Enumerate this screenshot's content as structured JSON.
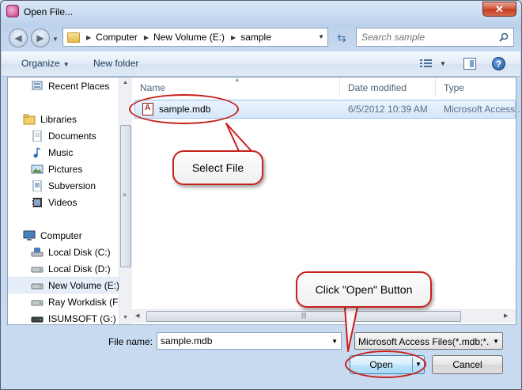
{
  "window": {
    "title": "Open File..."
  },
  "nav": {
    "back_arrow": "◀",
    "forward_arrow": "▶"
  },
  "address": {
    "crumbs": [
      "Computer",
      "New Volume (E:)",
      "sample"
    ]
  },
  "search": {
    "placeholder": "Search sample"
  },
  "toolbar": {
    "organize_label": "Organize",
    "new_folder_label": "New folder",
    "help_label": "?"
  },
  "sidebar": {
    "items": [
      {
        "label": "Recent Places",
        "icon": "recent-places-icon"
      },
      {
        "label": "Libraries",
        "icon": "libraries-icon"
      },
      {
        "label": "Documents",
        "icon": "documents-icon"
      },
      {
        "label": "Music",
        "icon": "music-icon"
      },
      {
        "label": "Pictures",
        "icon": "pictures-icon"
      },
      {
        "label": "Subversion",
        "icon": "subversion-icon"
      },
      {
        "label": "Videos",
        "icon": "videos-icon"
      },
      {
        "label": "Computer",
        "icon": "computer-icon"
      },
      {
        "label": "Local Disk (C:)",
        "icon": "drive-c-icon"
      },
      {
        "label": "Local Disk (D:)",
        "icon": "drive-icon"
      },
      {
        "label": "New Volume (E:)",
        "icon": "drive-icon",
        "selected": true
      },
      {
        "label": "Ray Workdisk (F:)",
        "icon": "drive-icon"
      },
      {
        "label": "ISUMSOFT (G:)",
        "icon": "drive-icon"
      }
    ]
  },
  "file_list": {
    "columns": [
      "Name",
      "Date modified",
      "Type"
    ],
    "rows": [
      {
        "name": "sample.mdb",
        "date": "6/5/2012 10:39 AM",
        "type": "Microsoft Access ...",
        "selected": true
      }
    ]
  },
  "bottom": {
    "file_name_label": "File name:",
    "file_name_value": "sample.mdb",
    "file_type_value": "Microsoft Access Files(*.mdb;*.",
    "open_label": "Open",
    "cancel_label": "Cancel"
  },
  "annotations": {
    "select_file": "Select File",
    "click_open": "Click \"Open\" Button"
  },
  "colors": {
    "callout_border": "#c8201c",
    "selection": "#d5e7fb"
  }
}
